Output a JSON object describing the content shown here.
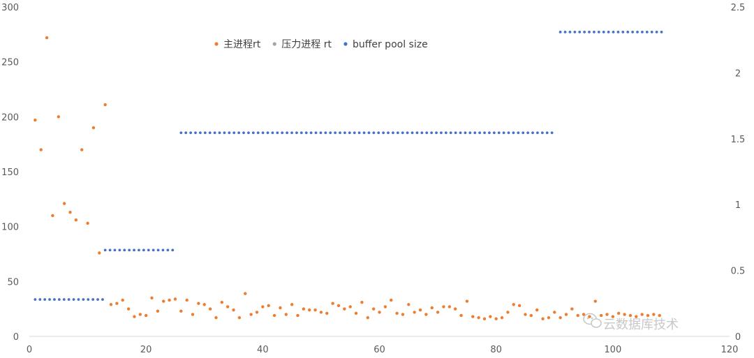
{
  "chart_data": {
    "type": "scatter",
    "xlim": [
      0,
      120
    ],
    "ylim": [
      0,
      300
    ],
    "y2lim": [
      0,
      2.5
    ],
    "x_ticks": [
      0,
      20,
      40,
      60,
      80,
      100,
      120
    ],
    "y_ticks": [
      0,
      50,
      100,
      150,
      200,
      250,
      300
    ],
    "y2_ticks": [
      0,
      0.5,
      1,
      1.5,
      2,
      2.5
    ],
    "grid": false,
    "legend_position": "top-center",
    "series": [
      {
        "name": "主进程rt",
        "color": "#ED7D31",
        "axis": "left",
        "x": [
          1,
          2,
          3,
          4,
          5,
          6,
          7,
          8,
          9,
          10,
          11,
          12,
          13,
          14,
          15,
          16,
          17,
          18,
          19,
          20,
          21,
          22,
          23,
          24,
          25,
          26,
          27,
          28,
          29,
          30,
          31,
          32,
          33,
          34,
          35,
          36,
          37,
          38,
          39,
          40,
          41,
          42,
          43,
          44,
          45,
          46,
          47,
          48,
          49,
          50,
          51,
          52,
          53,
          54,
          55,
          56,
          57,
          58,
          59,
          60,
          61,
          62,
          63,
          64,
          65,
          66,
          67,
          68,
          69,
          70,
          71,
          72,
          73,
          74,
          75,
          76,
          77,
          78,
          79,
          80,
          81,
          82,
          83,
          84,
          85,
          86,
          87,
          88,
          89,
          90,
          91,
          92,
          93,
          94,
          95,
          96,
          97,
          98,
          99,
          100,
          101,
          102,
          103,
          104,
          105,
          106,
          107,
          108
        ],
        "y": [
          197,
          170,
          272,
          110,
          200,
          121,
          113,
          106,
          170,
          103,
          190,
          76,
          211,
          29,
          30,
          33,
          25,
          18,
          20,
          19,
          35,
          23,
          32,
          33,
          34,
          23,
          33,
          20,
          30,
          29,
          25,
          17,
          31,
          27,
          24,
          17,
          39,
          20,
          22,
          27,
          28,
          19,
          26,
          20,
          29,
          19,
          25,
          24,
          24,
          22,
          21,
          30,
          28,
          25,
          27,
          21,
          31,
          17,
          25,
          22,
          27,
          33,
          21,
          20,
          29,
          22,
          24,
          20,
          26,
          22,
          27,
          27,
          25,
          19,
          32,
          18,
          17,
          16,
          18,
          16,
          17,
          22,
          29,
          28,
          20,
          19,
          24,
          16,
          17,
          22,
          17,
          20,
          25,
          19,
          20,
          18,
          32,
          19,
          20,
          18,
          21,
          20,
          19,
          18,
          20,
          19,
          20,
          19
        ]
      },
      {
        "name": "压力进程 rt",
        "color": "#A5A5A5",
        "axis": "left",
        "x": [],
        "y": []
      },
      {
        "name": "buffer pool size",
        "color": "#4472C4",
        "axis": "right",
        "segments": [
          {
            "x_start": 1,
            "x_end": 13,
            "y": 0.28
          },
          {
            "x_start": 13,
            "x_end": 25,
            "y": 0.655
          },
          {
            "x_start": 26,
            "x_end": 90,
            "y": 1.545
          },
          {
            "x_start": 91,
            "x_end": 109,
            "y": 2.31
          }
        ]
      }
    ]
  },
  "watermark": {
    "icon": "wechat-icon",
    "text": "云数据库技术"
  }
}
